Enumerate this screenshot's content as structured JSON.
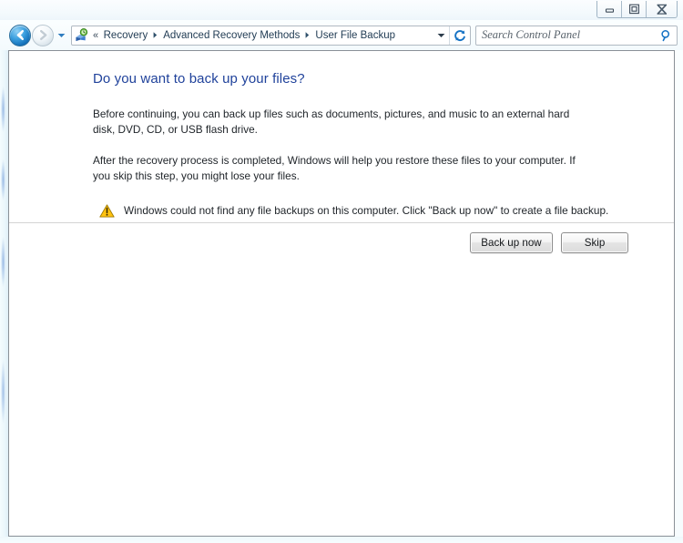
{
  "window": {
    "titlebar_buttons": [
      {
        "name": "minimize",
        "label": "–"
      },
      {
        "name": "restore",
        "label": "□"
      },
      {
        "name": "close",
        "label": "✕"
      }
    ]
  },
  "nav": {
    "back_tooltip": "Back",
    "forward_tooltip": "Forward",
    "recent_pages_tooltip": "Recent pages",
    "address_icon": "recovery-clock-icon",
    "overflow_chevrons": "«",
    "breadcrumbs": [
      "Recovery",
      "Advanced Recovery Methods",
      "User File Backup"
    ],
    "breadcrumb_separator": "▸",
    "address_dropdown_icon": "chevron-down-icon",
    "refresh_icon": "refresh-icon"
  },
  "search": {
    "placeholder": "Search Control Panel",
    "value": "",
    "icon": "search-icon"
  },
  "main": {
    "title": "Do you want to back up your files?",
    "paragraphs": [
      "Before continuing, you can back up files such as documents, pictures, and music to an external hard disk, DVD, CD, or USB flash drive.",
      "After the recovery process is completed, Windows will help you restore these files to  your computer.  If you skip this step, you might lose your files."
    ],
    "warning": {
      "icon": "warning-triangle-icon",
      "text": "Windows could not find any file backups on this computer. Click \"Back up now\" to create a file backup."
    },
    "buttons": {
      "backup": "Back up now",
      "skip": "Skip"
    }
  },
  "colors": {
    "heading": "#20429b",
    "body_text": "#21262b",
    "warning_yellow": "#ffc20e",
    "accent_blue": "#1572c4",
    "frame_border": "#8a9097"
  }
}
